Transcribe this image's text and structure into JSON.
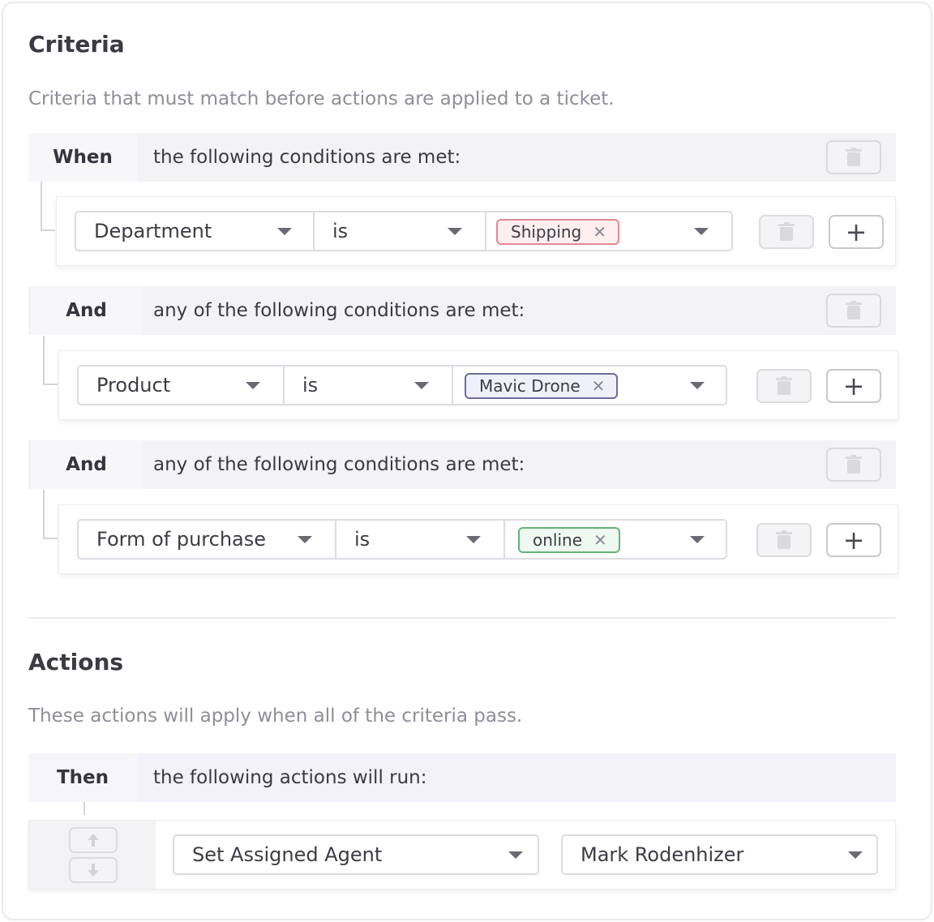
{
  "criteria": {
    "title": "Criteria",
    "description": "Criteria that must match before actions are applied to a ticket.",
    "groups": [
      {
        "keyword": "When",
        "text": "the following conditions are met:",
        "condition": {
          "field": "Department",
          "operator": "is",
          "value": "Shipping",
          "tag_color": "#e38892"
        }
      },
      {
        "keyword": "And",
        "text": "any of the following conditions are met:",
        "condition": {
          "field": "Product",
          "operator": "is",
          "value": "Mavic Drone",
          "tag_color": "#6d6d9e"
        }
      },
      {
        "keyword": "And",
        "text": "any of the following conditions are met:",
        "condition": {
          "field": "Form of purchase",
          "operator": "is",
          "value": "online",
          "tag_color": "#65b27a"
        }
      }
    ]
  },
  "actions": {
    "title": "Actions",
    "description": "These actions will apply when all of the criteria pass.",
    "group": {
      "keyword": "Then",
      "text": "the following actions will run:",
      "action": {
        "type": "Set Assigned Agent",
        "value": "Mark Rodenhizer"
      }
    }
  },
  "icons": {
    "trash": "trash-icon",
    "plus": "plus-icon",
    "remove": "close-icon",
    "caret": "chevron-down-icon",
    "up": "arrow-up-icon",
    "down": "arrow-down-icon"
  }
}
